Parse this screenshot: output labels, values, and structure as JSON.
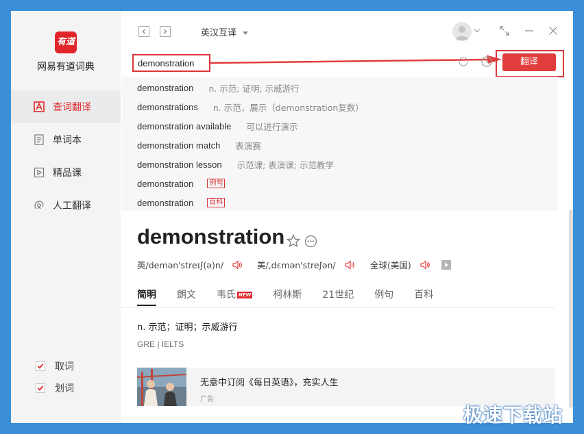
{
  "app": {
    "name": "网易有道词典",
    "logo_text": "有道"
  },
  "sidebar": {
    "items": [
      {
        "label": "查词翻译",
        "icon": "dictionary-icon",
        "active": true
      },
      {
        "label": "单词本",
        "icon": "notebook-icon",
        "active": false
      },
      {
        "label": "精品课",
        "icon": "course-icon",
        "active": false
      },
      {
        "label": "人工翻译",
        "icon": "human-translate-icon",
        "active": false
      }
    ],
    "options": [
      {
        "label": "取词",
        "checked": true
      },
      {
        "label": "划词",
        "checked": true
      }
    ]
  },
  "header": {
    "mode": "英汉互译"
  },
  "search": {
    "value": "demonstration",
    "button_label": "翻译"
  },
  "suggestions": [
    {
      "word": "demonstration",
      "definition": "n. 示范; 证明; 示威游行"
    },
    {
      "word": "demonstrations",
      "definition": "n. 示范，展示（demonstration复数）"
    },
    {
      "word": "demonstration available",
      "definition": "可以进行演示"
    },
    {
      "word": "demonstration match",
      "definition": "表演赛"
    },
    {
      "word": "demonstration lesson",
      "definition": "示范课; 表演课; 示范教学"
    },
    {
      "word": "demonstration",
      "tag": "例句"
    },
    {
      "word": "demonstration",
      "tag": "百科"
    }
  ],
  "result": {
    "headword": "demonstration",
    "pronunciations": [
      {
        "label": "英/demən'streɪʃ(ə)n/"
      },
      {
        "label": "美/,dɛmən'streʃən/"
      },
      {
        "label": "全球(美国)"
      }
    ],
    "tabs": [
      "简明",
      "朗文",
      "韦氏",
      "柯林斯",
      "21世纪",
      "例句",
      "百科"
    ],
    "new_badge": "NEW",
    "definition": "n. 示范；证明；示威游行",
    "exams": "GRE | IELTS"
  },
  "ad": {
    "title": "无意中订阅《每日英语》，充实人生",
    "label": "广告"
  },
  "watermark": "极速下载站",
  "colors": {
    "accent": "#e0262b",
    "background": "#3b8fd6"
  }
}
